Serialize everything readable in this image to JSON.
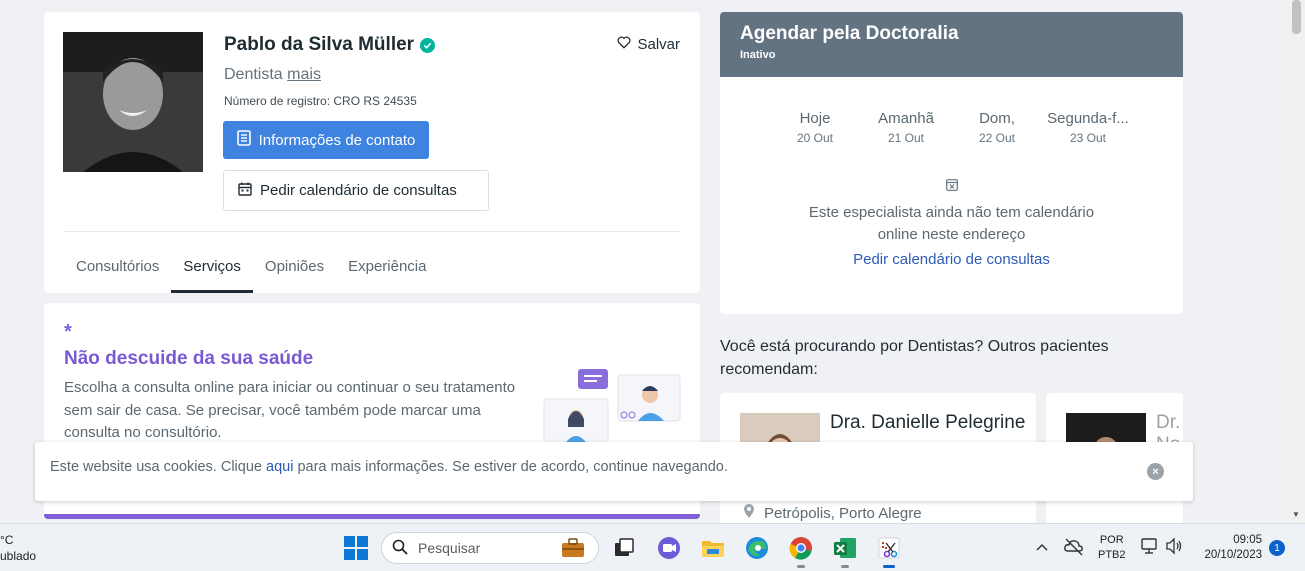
{
  "profile": {
    "name": "Pablo da Silva Müller",
    "save_label": "Salvar",
    "specialty": "Dentista",
    "specialty_more": "mais",
    "registration": "Número de registro: CRO RS 24535",
    "contact_button": "Informações de contato",
    "calendar_button": "Pedir calendário de consultas",
    "tabs": [
      {
        "label": "Consultórios",
        "active": false
      },
      {
        "label": "Serviços",
        "active": true
      },
      {
        "label": "Opiniões",
        "active": false
      },
      {
        "label": "Experiência",
        "active": false
      }
    ]
  },
  "promo": {
    "star": "*",
    "title": "Não descuide da sua saúde",
    "text": "Escolha a consulta online para iniciar ou continuar o seu tratamento sem sair de casa. Se precisar, você também pode marcar uma consulta no consultório."
  },
  "booking": {
    "title": "Agendar pela Doctoralia",
    "status": "Inativo",
    "days": [
      {
        "name": "Hoje",
        "date": "20 Out"
      },
      {
        "name": "Amanhã",
        "date": "21 Out"
      },
      {
        "name": "Dom,",
        "date": "22 Out"
      },
      {
        "name": "Segunda-f...",
        "date": "23 Out"
      }
    ],
    "no_calendar_line1": "Este especialista ainda não tem calendário",
    "no_calendar_line2": "online neste endereço",
    "request_link": "Pedir calendário de consultas"
  },
  "recommend": {
    "text": "Você está procurando por Dentistas? Outros pacientes recomendam:",
    "cards": [
      {
        "name": "Dra. Danielle Pelegrine",
        "location": "Petrópolis, Porto Alegre"
      },
      {
        "name": "Dr. No"
      }
    ]
  },
  "cookie": {
    "text_before": "Este website usa cookies. Clique ",
    "link": "aqui",
    "text_after": " para mais informações. Se estiver de acordo, continue navegando.",
    "close": "×"
  },
  "taskbar": {
    "weather_temp": "°C",
    "weather_desc": "ublado",
    "search_placeholder": "Pesquisar",
    "lang_line1": "POR",
    "lang_line2": "PTB2",
    "time": "09:05",
    "date": "20/10/2023",
    "notifications": "1"
  },
  "colors": {
    "primary_button": "#3d83df",
    "promo_accent": "#7a5ad4",
    "booking_header": "#647381",
    "link": "#2e5bb5"
  }
}
